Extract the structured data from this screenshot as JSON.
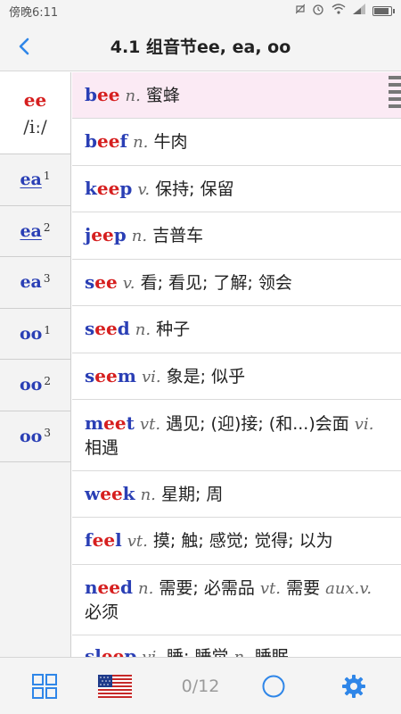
{
  "status": {
    "time": "傍晚6:11"
  },
  "header": {
    "title": "4.1 组音节ee, ea, oo"
  },
  "sidebar": {
    "active": {
      "label": "ee",
      "ipa": "/iː/"
    },
    "items": [
      {
        "label": "ea",
        "sup": "1"
      },
      {
        "label": "ea",
        "sup": "2"
      },
      {
        "label": "ea",
        "sup": "3"
      },
      {
        "label": "oo",
        "sup": "1"
      },
      {
        "label": "oo",
        "sup": "2"
      },
      {
        "label": "oo",
        "sup": "3"
      }
    ]
  },
  "words": [
    {
      "pre": "b",
      "hl": "ee",
      "post": "",
      "pos": "n.",
      "def": "蜜蜂"
    },
    {
      "pre": "b",
      "hl": "ee",
      "post": "f",
      "pos": "n.",
      "def": "牛肉"
    },
    {
      "pre": "k",
      "hl": "ee",
      "post": "p",
      "pos": "v.",
      "def": "保持; 保留"
    },
    {
      "pre": "j",
      "hl": "ee",
      "post": "p",
      "pos": "n.",
      "def": "吉普车"
    },
    {
      "pre": "s",
      "hl": "ee",
      "post": "",
      "pos": "v.",
      "def": "看; 看见; 了解; 领会"
    },
    {
      "pre": "s",
      "hl": "ee",
      "post": "d",
      "pos": "n.",
      "def": "种子"
    },
    {
      "pre": "s",
      "hl": "ee",
      "post": "m",
      "pos": "vi.",
      "def": "象是; 似乎"
    },
    {
      "pre": "m",
      "hl": "ee",
      "post": "t",
      "pos": "vt.",
      "def": "遇见; (迎)接; (和...)会面",
      "pos2": "vi.",
      "def2": "相遇"
    },
    {
      "pre": "w",
      "hl": "ee",
      "post": "k",
      "pos": "n.",
      "def": "星期; 周"
    },
    {
      "pre": "f",
      "hl": "ee",
      "post": "l",
      "pos": "vt.",
      "def": "摸; 触; 感觉; 觉得; 以为"
    },
    {
      "pre": "n",
      "hl": "ee",
      "post": "d",
      "pos": "n.",
      "def": "需要; 必需品",
      "pos2": "vt.",
      "def2": "需要",
      "pos3": "aux.v.",
      "def3": "必须"
    },
    {
      "pre": "sl",
      "hl": "ee",
      "post": "p",
      "pos": "vi.",
      "def": "睡; 睡觉",
      "pos2": "n.",
      "def2": "睡眠"
    }
  ],
  "bottom": {
    "counter": "0/12"
  },
  "colors": {
    "word": "#2a3fb5",
    "highlight": "#d61f1f",
    "accent": "#2f86e8",
    "selected_row": "#fbeaf4"
  }
}
